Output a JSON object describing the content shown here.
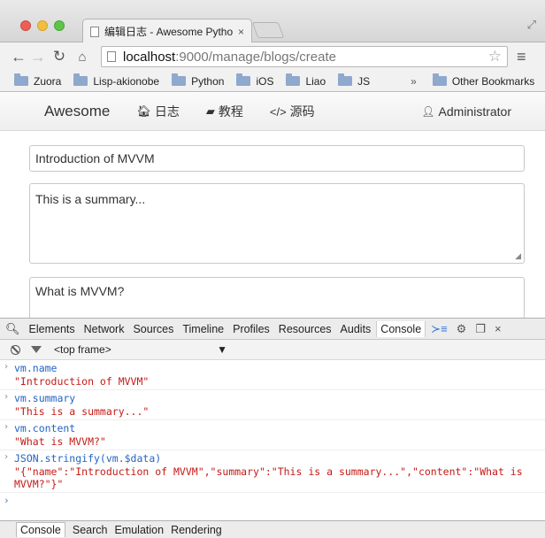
{
  "window": {
    "tab_title": "编辑日志 - Awesome Pytho",
    "tab_close": "×"
  },
  "toolbar": {
    "url_host": "localhost",
    "url_path": ":9000/manage/blogs/create"
  },
  "bookmarks": {
    "items": [
      {
        "label": "Zuora"
      },
      {
        "label": "Lisp-akionobe"
      },
      {
        "label": "Python"
      },
      {
        "label": "iOS"
      },
      {
        "label": "Liao"
      },
      {
        "label": "JS"
      }
    ],
    "more": "»",
    "other": "Other Bookmarks"
  },
  "site": {
    "brand": "Awesome",
    "nav": [
      {
        "label": "日志",
        "icon": "home-icon"
      },
      {
        "label": "教程",
        "icon": "book-icon"
      },
      {
        "label": "源码",
        "icon": "code-icon"
      }
    ],
    "user": "Administrator"
  },
  "form": {
    "name": "Introduction of MVVM",
    "summary": "This is a summary...",
    "content": "What is MVVM?"
  },
  "devtools": {
    "tabs": [
      "Elements",
      "Network",
      "Sources",
      "Timeline",
      "Profiles",
      "Resources",
      "Audits",
      "Console"
    ],
    "active_tab": "Console",
    "close": "×",
    "frame": "<top frame>",
    "frame_arrow": "▼",
    "console_entries": [
      {
        "command": "vm.name",
        "result": "\"Introduction of MVVM\""
      },
      {
        "command": "vm.summary",
        "result": "\"This is a summary...\""
      },
      {
        "command": "vm.content",
        "result": "\"What is MVVM?\""
      },
      {
        "command": "JSON.stringify(vm.$data)",
        "result": "\"{\"name\":\"Introduction of MVVM\",\"summary\":\"This is a summary...\",\"content\":\"What is MVVM?\"}\""
      }
    ],
    "drawer_tabs": [
      "Console",
      "Search",
      "Emulation",
      "Rendering"
    ]
  },
  "colors": {
    "command": "#2364c4",
    "result": "#c41a16"
  }
}
